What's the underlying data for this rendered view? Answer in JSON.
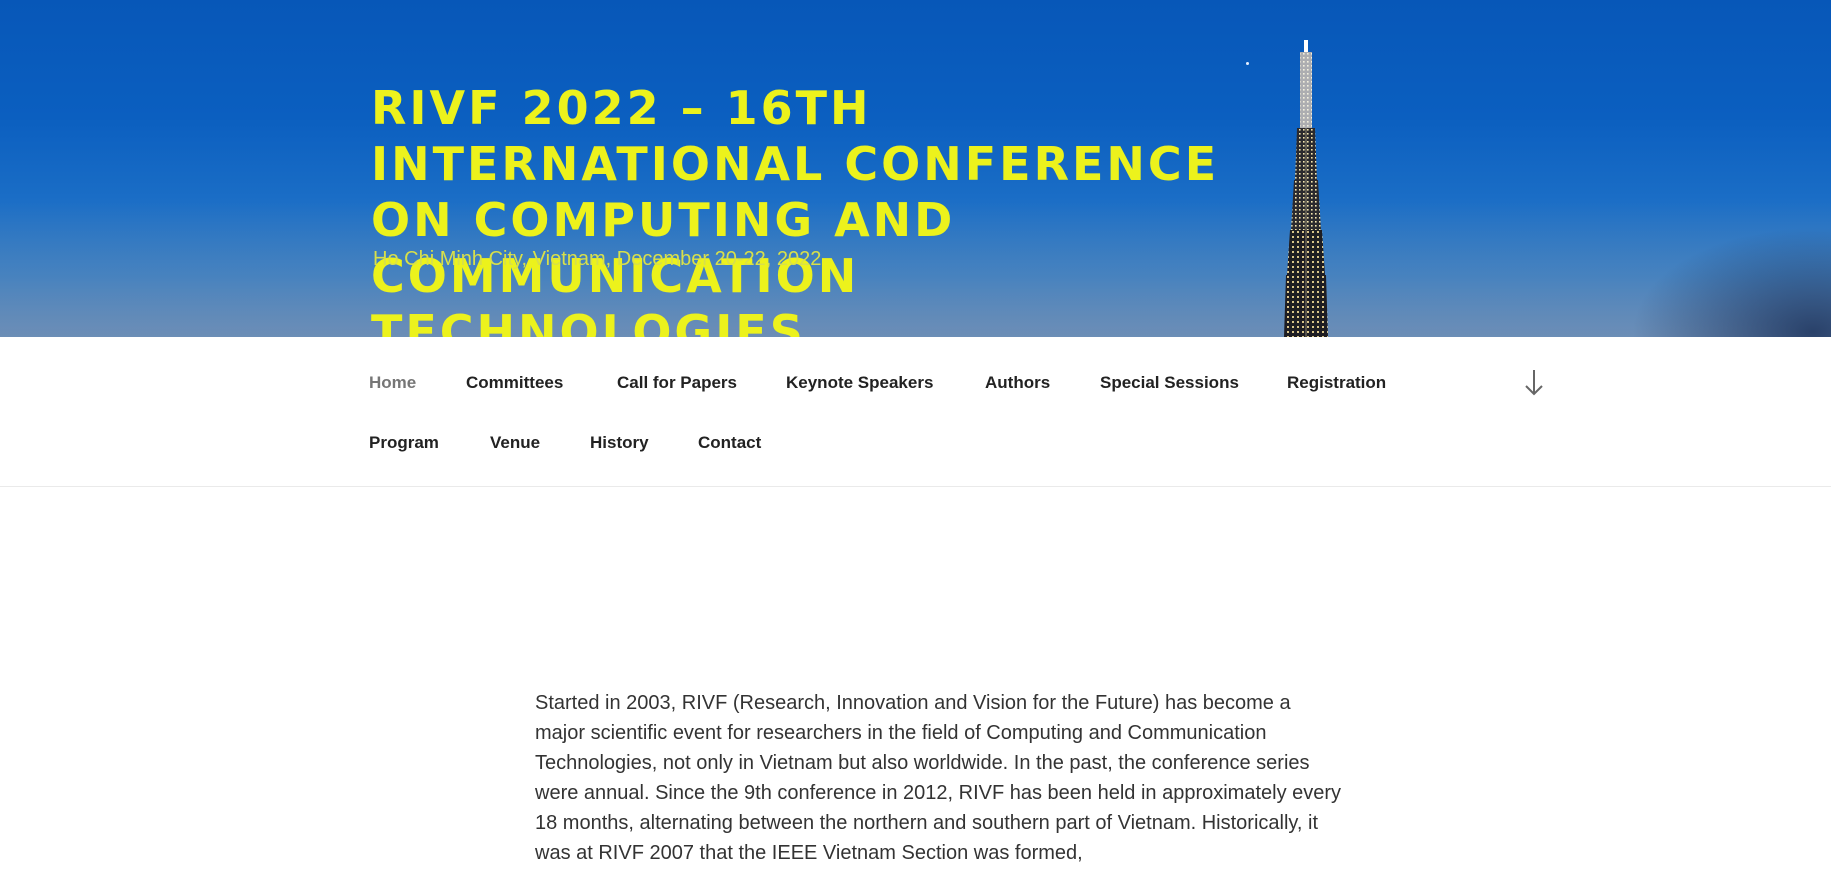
{
  "header": {
    "title": "RIVF 2022 – 16TH INTERNATIONAL CONFERENCE ON COMPUTING AND COMMUNICATION TECHNOLOGIES",
    "tagline": "Ho Chi Minh City, Vietnam, December 20-22, 2022"
  },
  "nav": {
    "items": [
      {
        "label": "Home"
      },
      {
        "label": "Committees"
      },
      {
        "label": "Call for Papers"
      },
      {
        "label": "Keynote Speakers"
      },
      {
        "label": "Authors"
      },
      {
        "label": "Special Sessions"
      },
      {
        "label": "Registration"
      },
      {
        "label": "Program"
      },
      {
        "label": "Venue"
      },
      {
        "label": "History"
      },
      {
        "label": "Contact"
      }
    ],
    "scroll_icon": "arrow-down-icon"
  },
  "main": {
    "intro": "Started in 2003, RIVF (Research, Innovation and Vision for the Future) has become a major scientific event for researchers in the field of Computing and Communication Technologies, not only in Vietnam but also worldwide. In the past, the conference series were annual. Since the 9th conference in 2012, RIVF has been held in approximately every 18 months, alternating between the northern and southern part of Vietnam. Historically, it was at RIVF 2007 that the IEEE Vietnam Section was formed,"
  },
  "colors": {
    "title": "#ecf21c",
    "tagline": "#d8e04a",
    "banner": "#0757b8",
    "nav_active": "#767676"
  }
}
